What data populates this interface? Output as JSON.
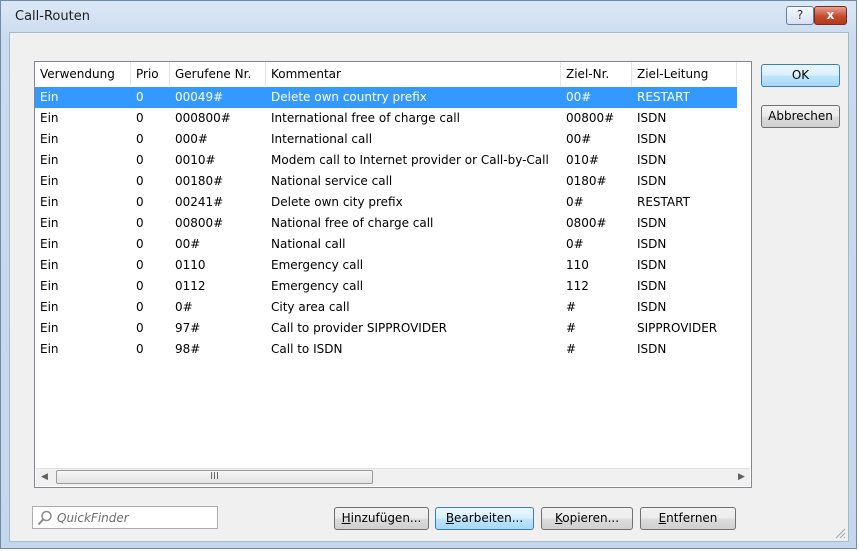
{
  "window": {
    "title": "Call-Routen"
  },
  "caption_buttons": {
    "help": "?",
    "close": "x"
  },
  "table": {
    "columns": [
      "Verwendung",
      "Prio",
      "Gerufene Nr.",
      "Kommentar",
      "Ziel-Nr.",
      "Ziel-Leitung"
    ],
    "rows": [
      [
        "Ein",
        "0",
        "00049#",
        "Delete own country prefix",
        "00#",
        "RESTART"
      ],
      [
        "Ein",
        "0",
        "000800#",
        "International free of charge call",
        "00800#",
        "ISDN"
      ],
      [
        "Ein",
        "0",
        "000#",
        "International call",
        "00#",
        "ISDN"
      ],
      [
        "Ein",
        "0",
        "0010#",
        "Modem call to Internet provider or Call-by-Call",
        "010#",
        "ISDN"
      ],
      [
        "Ein",
        "0",
        "00180#",
        "National service call",
        "0180#",
        "ISDN"
      ],
      [
        "Ein",
        "0",
        "00241#",
        "Delete own city prefix",
        "0#",
        "RESTART"
      ],
      [
        "Ein",
        "0",
        "00800#",
        "National free of charge call",
        "0800#",
        "ISDN"
      ],
      [
        "Ein",
        "0",
        "00#",
        "National call",
        "0#",
        "ISDN"
      ],
      [
        "Ein",
        "0",
        "0110",
        "Emergency call",
        "110",
        "ISDN"
      ],
      [
        "Ein",
        "0",
        "0112",
        "Emergency call",
        "112",
        "ISDN"
      ],
      [
        "Ein",
        "0",
        "0#",
        "City area call",
        "#",
        "ISDN"
      ],
      [
        "Ein",
        "0",
        "97#",
        "Call to provider SIPPROVIDER",
        "#",
        "SIPPROVIDER"
      ],
      [
        "Ein",
        "0",
        "98#",
        "Call to ISDN",
        "#",
        "ISDN"
      ]
    ],
    "selected_row": 0
  },
  "scrollbar": {
    "left_arrow": "◀",
    "right_arrow": "▶",
    "thumb_grip": "III"
  },
  "buttons": {
    "ok": "OK",
    "cancel": "Abbrechen",
    "add": {
      "key": "H",
      "rest": "inzufügen..."
    },
    "edit": {
      "key": "B",
      "rest": "earbeiten..."
    },
    "copy": {
      "key": "K",
      "rest": "opieren..."
    },
    "remove": {
      "key": "E",
      "rest": "ntfernen"
    }
  },
  "quickfinder": {
    "placeholder": "QuickFinder",
    "icon": "search-icon"
  },
  "colors": {
    "selection": "#3399ff",
    "title_bar": "#c9dbef",
    "close_button": "#c64a2e"
  }
}
